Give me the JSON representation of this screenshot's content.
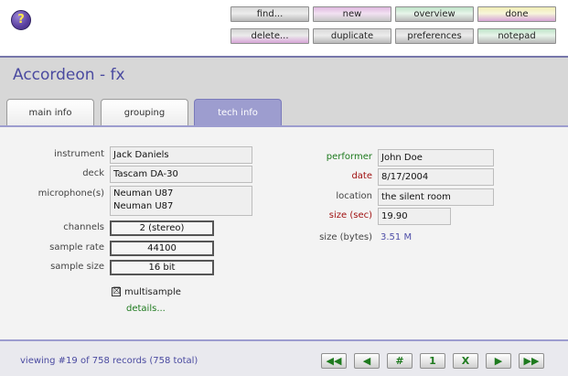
{
  "toolbar": {
    "help_label": "?",
    "buttons": {
      "find": "find...",
      "new": "new",
      "overview": "overview",
      "done": "done",
      "delete": "delete...",
      "duplicate": "duplicate",
      "preferences": "preferences",
      "notepad": "notepad"
    }
  },
  "header": {
    "title": "Accordeon - fx"
  },
  "tabs": [
    {
      "label": "main info"
    },
    {
      "label": "grouping"
    },
    {
      "label": "tech info",
      "active": true
    }
  ],
  "left": {
    "instrument_label": "instrument",
    "instrument": "Jack Daniels",
    "deck_label": "deck",
    "deck": "Tascam DA-30",
    "microphones_label": "microphone(s)",
    "microphones": [
      "Neuman U87",
      "Neuman U87"
    ],
    "channels_label": "channels",
    "channels": "2 (stereo)",
    "sample_rate_label": "sample rate",
    "sample_rate": "44100",
    "sample_size_label": "sample size",
    "sample_size": "16 bit",
    "multisample_label": "multisample",
    "multisample_checked": true,
    "multisample_check_glyph": "☒",
    "details_label": "details..."
  },
  "right": {
    "performer_label": "performer",
    "performer": "John Doe",
    "date_label": "date",
    "date": "8/17/2004",
    "location_label": "location",
    "location": "the silent room",
    "size_sec_label": "size (sec)",
    "size_sec": "19.90",
    "size_bytes_label": "size (bytes)",
    "size_bytes": "3.51 M"
  },
  "status": {
    "text": "viewing #19 of 758 records (758 total)"
  },
  "nav": {
    "first": "◀◀",
    "prev": "◀",
    "goto": "#",
    "page": "1",
    "close": "X",
    "next": "▶",
    "last": "▶▶"
  },
  "colors": {
    "accent": "#9d9dcf",
    "title": "#4a4aa0",
    "green_label": "#1e7a1e",
    "red_label": "#a01010"
  }
}
